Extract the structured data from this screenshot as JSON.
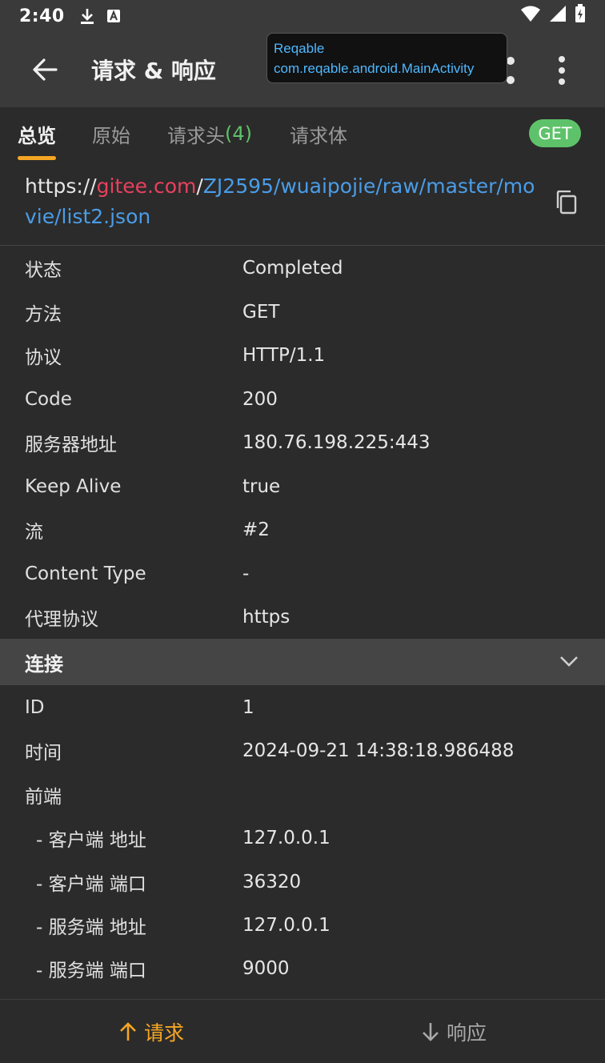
{
  "status_bar": {
    "time": "2:40"
  },
  "app_bar": {
    "title": "请求 & 响应"
  },
  "tooltip": {
    "line1": "Reqable",
    "line2": "com.reqable.android.MainActivity"
  },
  "tabs": [
    {
      "label": "总览",
      "count": ""
    },
    {
      "label": "原始",
      "count": ""
    },
    {
      "label": "请求头",
      "count": "(4)"
    },
    {
      "label": "请求体",
      "count": ""
    }
  ],
  "method_badge": "GET",
  "url": {
    "scheme": "https://",
    "host": "gitee.com",
    "sep": "/",
    "path": "ZJ2595/wuaipojie/raw/master/movie/list2.json"
  },
  "overview": [
    {
      "key": "状态",
      "value": "Completed"
    },
    {
      "key": "方法",
      "value": "GET"
    },
    {
      "key": "协议",
      "value": "HTTP/1.1"
    },
    {
      "key": "Code",
      "value": "200"
    },
    {
      "key": "服务器地址",
      "value": "180.76.198.225:443"
    },
    {
      "key": "Keep Alive",
      "value": "true"
    },
    {
      "key": "流",
      "value": "#2"
    },
    {
      "key": "Content Type",
      "value": "-"
    },
    {
      "key": "代理协议",
      "value": "https"
    }
  ],
  "connection": {
    "title": "连接",
    "rows": [
      {
        "key": "ID",
        "value": "1"
      },
      {
        "key": "时间",
        "value": "2024-09-21 14:38:18.986488"
      },
      {
        "key": "前端",
        "value": ""
      },
      {
        "key": "- 客户端 地址",
        "value": "127.0.0.1"
      },
      {
        "key": "- 客户端 端口",
        "value": "36320"
      },
      {
        "key": "- 服务端 地址",
        "value": "127.0.0.1"
      },
      {
        "key": "- 服务端 端口",
        "value": "9000"
      }
    ]
  },
  "bottom_bar": {
    "request_label": "请求",
    "response_label": "响应"
  },
  "colors": {
    "accent": "#f5a623",
    "success": "#5ec26a",
    "host": "#e8405e",
    "path": "#4a9de8",
    "tooltip_text": "#4fb8ff"
  }
}
